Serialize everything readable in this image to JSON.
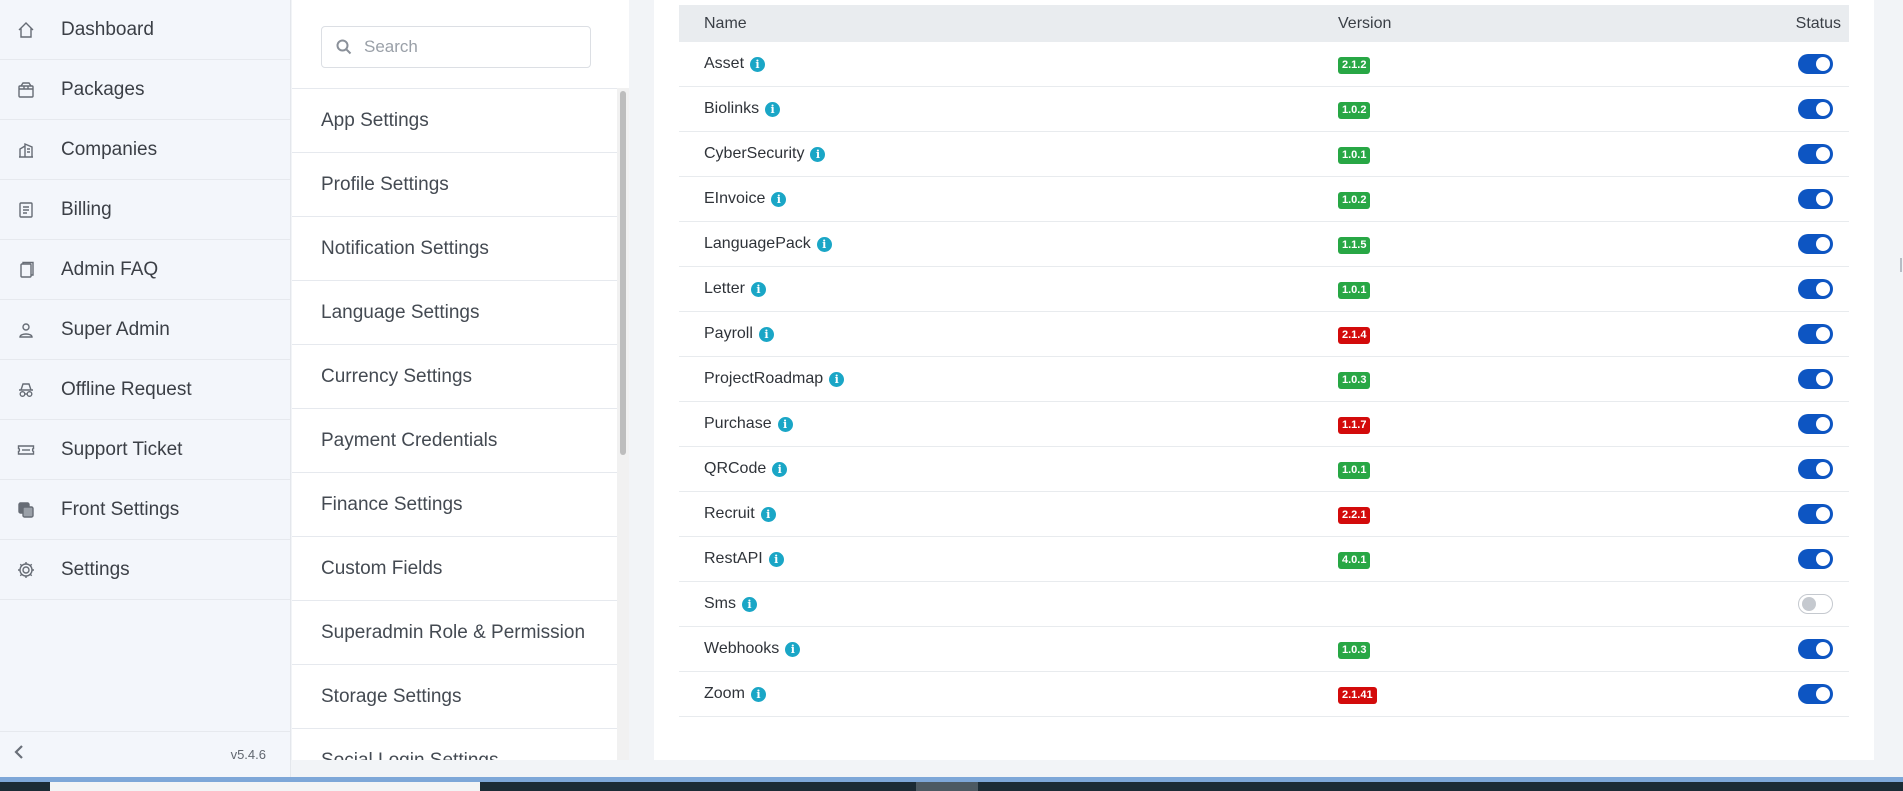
{
  "sidebar": {
    "items": [
      {
        "label": "Dashboard",
        "icon": "home-icon"
      },
      {
        "label": "Packages",
        "icon": "package-icon"
      },
      {
        "label": "Companies",
        "icon": "building-icon"
      },
      {
        "label": "Billing",
        "icon": "receipt-icon"
      },
      {
        "label": "Admin FAQ",
        "icon": "document-icon"
      },
      {
        "label": "Super Admin",
        "icon": "user-icon"
      },
      {
        "label": "Offline Request",
        "icon": "incognito-icon"
      },
      {
        "label": "Support Ticket",
        "icon": "ticket-icon"
      },
      {
        "label": "Front Settings",
        "icon": "layers-icon"
      },
      {
        "label": "Settings",
        "icon": "gear-icon"
      }
    ],
    "version": "v5.4.6"
  },
  "settings_menu": {
    "search_placeholder": "Search",
    "items": [
      "App Settings",
      "Profile Settings",
      "Notification Settings",
      "Language Settings",
      "Currency Settings",
      "Payment Credentials",
      "Finance Settings",
      "Custom Fields",
      "Superadmin Role & Permission",
      "Storage Settings",
      "Social Login Settings"
    ]
  },
  "modules_table": {
    "headers": {
      "name": "Name",
      "version": "Version",
      "status": "Status"
    },
    "rows": [
      {
        "name": "Asset",
        "version": "2.1.2",
        "version_color": "#28a745",
        "enabled": true
      },
      {
        "name": "Biolinks",
        "version": "1.0.2",
        "version_color": "#28a745",
        "enabled": true
      },
      {
        "name": "CyberSecurity",
        "version": "1.0.1",
        "version_color": "#28a745",
        "enabled": true
      },
      {
        "name": "EInvoice",
        "version": "1.0.2",
        "version_color": "#28a745",
        "enabled": true
      },
      {
        "name": "LanguagePack",
        "version": "1.1.5",
        "version_color": "#28a745",
        "enabled": true
      },
      {
        "name": "Letter",
        "version": "1.0.1",
        "version_color": "#28a745",
        "enabled": true
      },
      {
        "name": "Payroll",
        "version": "2.1.4",
        "version_color": "#d30b0b",
        "enabled": true
      },
      {
        "name": "ProjectRoadmap",
        "version": "1.0.3",
        "version_color": "#28a745",
        "enabled": true
      },
      {
        "name": "Purchase",
        "version": "1.1.7",
        "version_color": "#d30b0b",
        "enabled": true
      },
      {
        "name": "QRCode",
        "version": "1.0.1",
        "version_color": "#28a745",
        "enabled": true
      },
      {
        "name": "Recruit",
        "version": "2.2.1",
        "version_color": "#d30b0b",
        "enabled": true
      },
      {
        "name": "RestAPI",
        "version": "4.0.1",
        "version_color": "#28a745",
        "enabled": true
      },
      {
        "name": "Sms",
        "version": "",
        "version_color": "",
        "enabled": false
      },
      {
        "name": "Webhooks",
        "version": "1.0.3",
        "version_color": "#28a745",
        "enabled": true
      },
      {
        "name": "Zoom",
        "version": "2.1.41",
        "version_color": "#d30b0b",
        "enabled": true
      }
    ]
  },
  "colors": {
    "toggle_on": "#0d55c2",
    "badge_green": "#28a745",
    "badge_red": "#d30b0b",
    "info_icon": "#1aa6c6"
  }
}
